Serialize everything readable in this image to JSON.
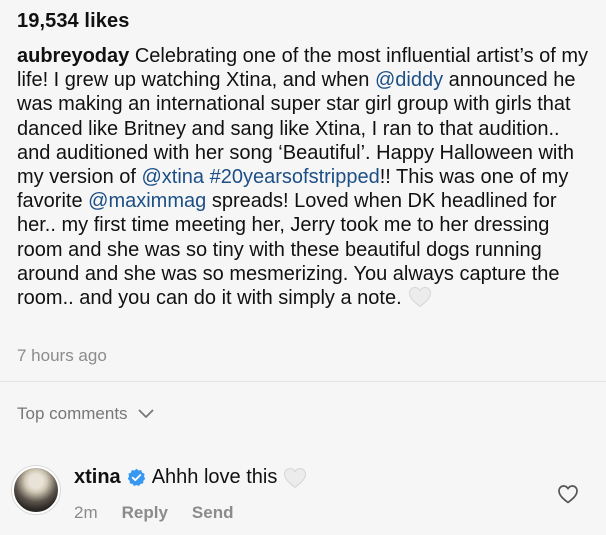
{
  "post": {
    "likes": "19,534 likes",
    "caption_user": "aubreyoday",
    "caption_parts": [
      {
        "text": " Celebrating one of the most influential artist’s of my life! I grew up watching Xtina, and when ",
        "link": false
      },
      {
        "text": "@diddy",
        "link": true
      },
      {
        "text": " announced he was making an international super star girl group with girls that danced like Britney and sang like Xtina, I ran to that audition.. and auditioned with her song ‘Beautiful’. Happy Halloween with my version of ",
        "link": false
      },
      {
        "text": "@xtina",
        "link": true
      },
      {
        "text": " ",
        "link": false
      },
      {
        "text": "#20yearsofstripped",
        "link": true
      },
      {
        "text": "!! This was one of my favorite ",
        "link": false
      },
      {
        "text": "@maximmag",
        "link": true
      },
      {
        "text": " spreads! Loved when DK headlined for her.. my first time meeting her, Jerry took me to her dressing room and she was so tiny with these beautiful dogs running around and she was so mesmerizing. You always capture the room.. and you can do it with simply a note.",
        "link": false
      }
    ],
    "time": "7 hours ago"
  },
  "comments": {
    "header": "Top comments",
    "items": [
      {
        "user": "xtina",
        "text": "Ahhh love this",
        "time": "2m",
        "reply_label": "Reply",
        "send_label": "Send"
      }
    ]
  },
  "colors": {
    "link": "#1c4f86",
    "verified": "#3897f0",
    "muted": "#8b8b8b"
  },
  "icons": [
    "white-heart-emoji-icon",
    "chevron-down-icon",
    "verified-badge-icon",
    "heart-outline-icon"
  ]
}
